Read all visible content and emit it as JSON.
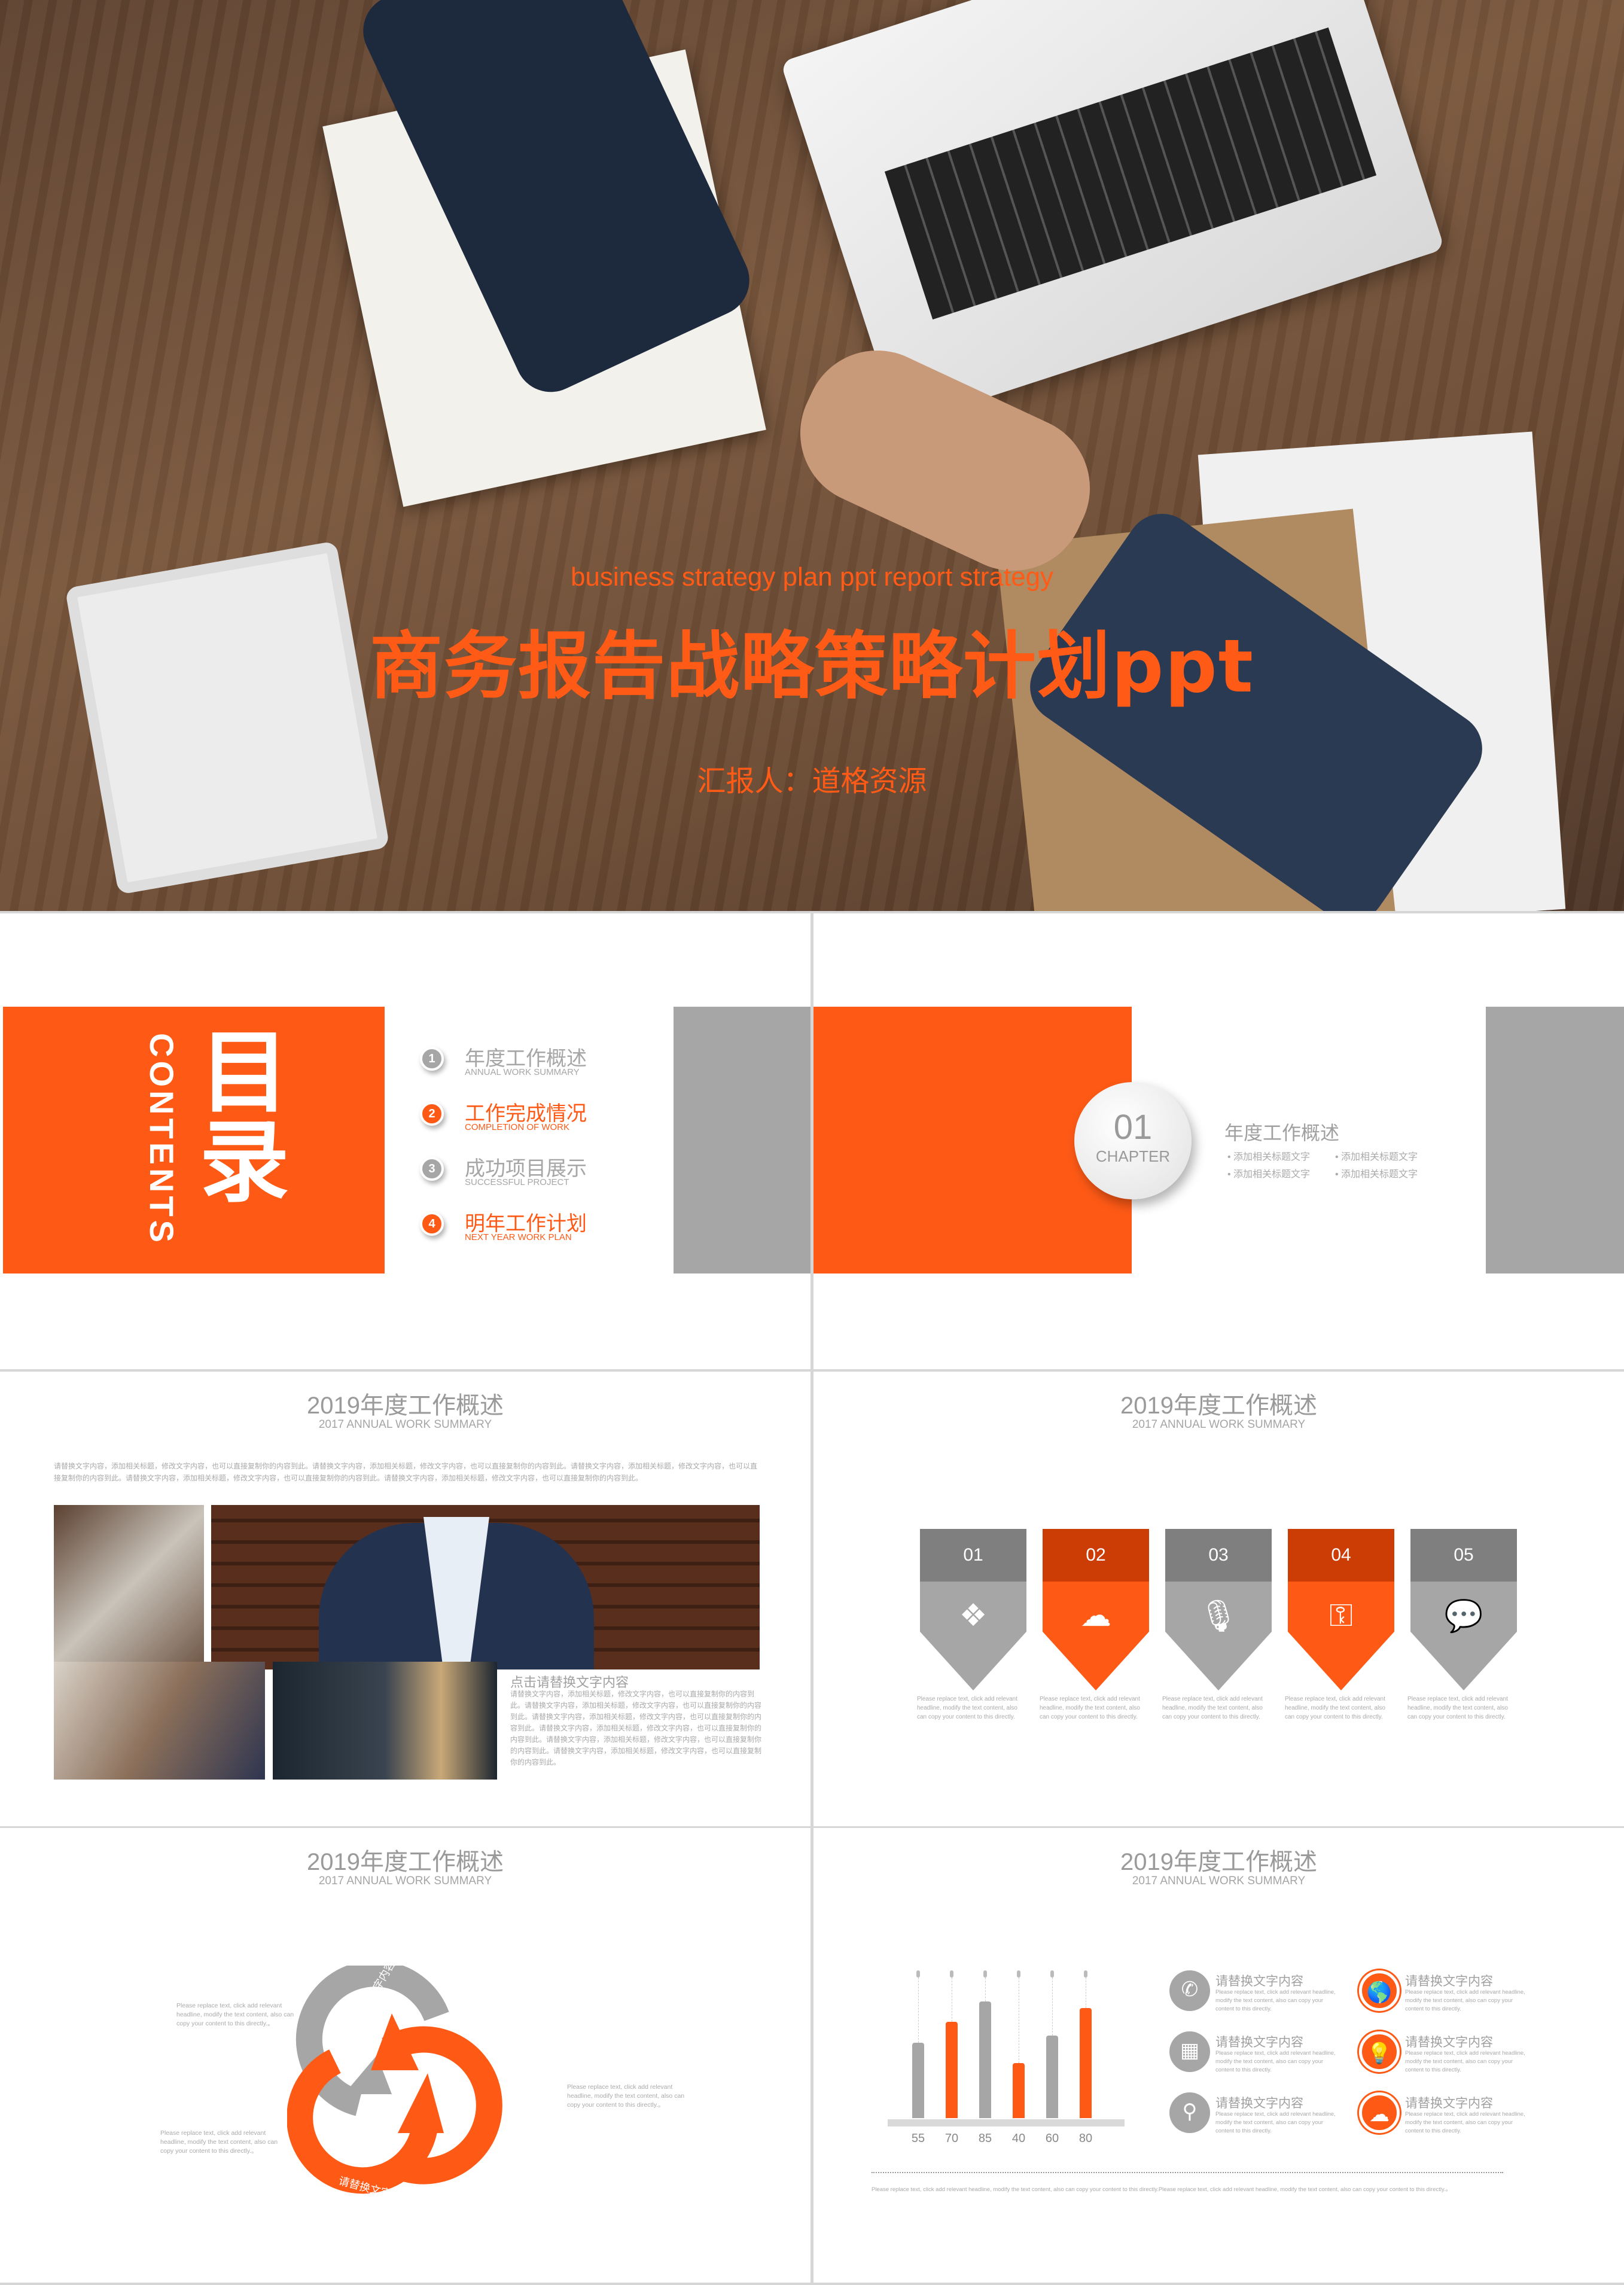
{
  "cover": {
    "subtitle_en": "business strategy plan ppt report strategy",
    "title": "商务报告战略策略计划ppt",
    "reporter": "汇报人：道格资源"
  },
  "contents": {
    "title_cn": "目录",
    "title_en": "CONTENTS",
    "items": [
      {
        "num": "1",
        "cn": "年度工作概述",
        "en": "ANNUAL WORK SUMMARY",
        "color": "#a6a6a6"
      },
      {
        "num": "2",
        "cn": "工作完成情况",
        "en": "COMPLETION OF WORK",
        "color": "#fe5a16"
      },
      {
        "num": "3",
        "cn": "成功项目展示",
        "en": "SUCCESSFUL PROJECT",
        "color": "#a6a6a6"
      },
      {
        "num": "4",
        "cn": "明年工作计划",
        "en": "NEXT YEAR WORK PLAN",
        "color": "#fe5a16"
      }
    ]
  },
  "chapter": {
    "num": "01",
    "label": "CHAPTER",
    "title": "年度工作概述",
    "bullets": [
      "添加相关标题文字",
      "添加相关标题文字",
      "添加相关标题文字",
      "添加相关标题文字"
    ]
  },
  "slide_header": {
    "title": "2019年度工作概述",
    "subtitle": "2017 ANNUAL WORK SUMMARY"
  },
  "overview": {
    "intro": "请替换文字内容，添加相关标题，修改文字内容，也可以直接复制你的内容到此。请替换文字内容，添加相关标题，修改文字内容，也可以直接复制你的内容到此。请替换文字内容，添加相关标题，修改文字内容，也可以直接复制你的内容到此。请替换文字内容，添加相关标题，修改文字内容，也可以直接复制你的内容到此。请替换文字内容，添加相关标题，修改文字内容，也可以直接复制你的内容到此。",
    "heading": "点击请替换文字内容",
    "body": "请替换文字内容，添加相关标题，修改文字内容，也可以直接复制你的内容到此。请替换文字内容，添加相关标题，修改文字内容，也可以直接复制你的内容到此。请替换文字内容，添加相关标题，修改文字内容，也可以直接复制你的内容到此。请替换文字内容，添加相关标题，修改文字内容，也可以直接复制你的内容到此。请替换文字内容，添加相关标题，修改文字内容，也可以直接复制你的内容到此。请替换文字内容，添加相关标题，修改文字内容，也可以直接复制你的内容到此。"
  },
  "steps": [
    {
      "num": "01",
      "icon": "dropbox-icon",
      "accent": false,
      "text": "Please replace text, click add relevant headline, modify the text content, also can copy your content to this directly."
    },
    {
      "num": "02",
      "icon": "cloud-upload-icon",
      "accent": true,
      "text": "Please replace text, click add relevant headline, modify the text content, also can copy your content to this directly."
    },
    {
      "num": "03",
      "icon": "microphone-icon",
      "accent": false,
      "text": "Please replace text, click add relevant headline, modify the text content, also can copy your content to this directly."
    },
    {
      "num": "04",
      "icon": "key-icon",
      "accent": true,
      "text": "Please replace text, click add relevant headline, modify the text content, also can copy your content to this directly."
    },
    {
      "num": "05",
      "icon": "chat-bubbles-icon",
      "accent": false,
      "text": "Please replace text, click add relevant headline, modify the text content, also can copy your content to this directly."
    }
  ],
  "cycle": {
    "arc_label": "请替换文字内容",
    "texts": [
      "Please replace text, click add relevant headline, modify the text content, also can copy your content to this directly.。",
      "Please replace text, click add relevant headline, modify the text content, also can copy your content to this directly.。",
      "Please replace text, click add relevant headline, modify the text content, also can copy your content to this directly.。"
    ]
  },
  "chart_data": {
    "type": "bar",
    "categories": [
      "55",
      "70",
      "85",
      "40",
      "60",
      "80"
    ],
    "values": [
      55,
      70,
      85,
      40,
      60,
      80
    ],
    "colors": [
      "#a6a6a6",
      "#fe5a16",
      "#a6a6a6",
      "#fe5a16",
      "#a6a6a6",
      "#fe5a16"
    ]
  },
  "features": [
    {
      "icon": "phone-icon",
      "accent": false,
      "title": "请替换文字内容",
      "text": "Please replace text, click add relevant headline, modify the text content, also can copy your content to this directly."
    },
    {
      "icon": "globe-icon",
      "accent": true,
      "title": "请替换文字内容",
      "text": "Please replace text, click add relevant headline, modify the text content, also can copy your content to this directly."
    },
    {
      "icon": "calendar-icon",
      "accent": false,
      "title": "请替换文字内容",
      "text": "Please replace text, click add relevant headline, modify the text content, also can copy your content to this directly."
    },
    {
      "icon": "lightbulb-icon",
      "accent": true,
      "title": "请替换文字内容",
      "text": "Please replace text, click add relevant headline, modify the text content, also can copy your content to this directly."
    },
    {
      "icon": "location-pin-icon",
      "accent": false,
      "title": "请替换文字内容",
      "text": "Please replace text, click add relevant headline, modify the text content, also can copy your content to this directly."
    },
    {
      "icon": "cloud-download-icon",
      "accent": true,
      "title": "请替换文字内容",
      "text": "Please replace text, click add relevant headline, modify the text content, also can copy your content to this directly."
    }
  ],
  "footnote": "Please replace text, click add relevant headline, modify the text content, also can copy your content to this directly.Please replace text, click add relevant headline, modify the text content, also can copy your content to this directly.。",
  "colors": {
    "accent": "#fe5a16",
    "accent_dark": "#cc3d06",
    "gray": "#a6a6a6",
    "gray_dark": "#7f7f7f"
  }
}
